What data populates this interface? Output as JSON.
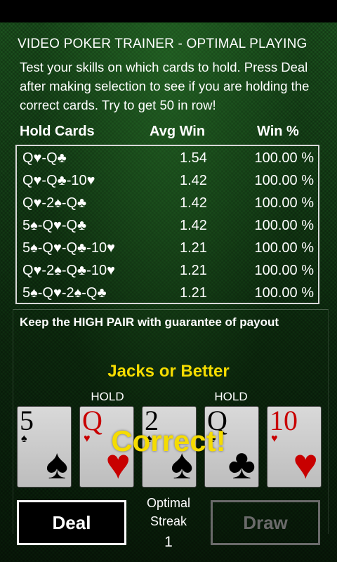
{
  "header": {
    "title": "VIDEO POKER TRAINER - OPTIMAL PLAYING",
    "instructions": "Test your skills on which cards to hold.  Press Deal after making selection to see if you are holding the correct cards.  Try to get 50 in row!"
  },
  "table": {
    "columns": [
      "Hold Cards",
      "Avg Win",
      "Win %"
    ],
    "rows": [
      [
        "Q♥-Q♣",
        "1.54",
        "100.00 %"
      ],
      [
        "Q♥-Q♣-10♥",
        "1.42",
        "100.00 %"
      ],
      [
        "Q♥-2♠-Q♣",
        "1.42",
        "100.00 %"
      ],
      [
        "5♠-Q♥-Q♣",
        "1.42",
        "100.00 %"
      ],
      [
        "5♠-Q♥-Q♣-10♥",
        "1.21",
        "100.00 %"
      ],
      [
        "Q♥-2♠-Q♣-10♥",
        "1.21",
        "100.00 %"
      ],
      [
        "5♠-Q♥-2♠-Q♣",
        "1.21",
        "100.00 %"
      ]
    ]
  },
  "hint": "Keep the HIGH PAIR with guarantee of payout",
  "game": {
    "name": "Jacks or Better",
    "hold_label": "HOLD",
    "result": "Correct!",
    "cards": [
      {
        "rank": "5",
        "suit": "♠",
        "color": "black",
        "held": false
      },
      {
        "rank": "Q",
        "suit": "♥",
        "color": "red",
        "held": true
      },
      {
        "rank": "2",
        "suit": "♠",
        "color": "black",
        "held": false
      },
      {
        "rank": "Q",
        "suit": "♣",
        "color": "black",
        "held": true
      },
      {
        "rank": "10",
        "suit": "♥",
        "color": "red",
        "held": false
      }
    ]
  },
  "controls": {
    "deal_label": "Deal",
    "draw_label": "Draw",
    "streak_label_line1": "Optimal",
    "streak_label_line2": "Streak",
    "streak_value": "1"
  },
  "colors": {
    "accent_yellow": "#f5dc00",
    "heart_red": "#c80000",
    "felt_green": "#1f5a22"
  }
}
